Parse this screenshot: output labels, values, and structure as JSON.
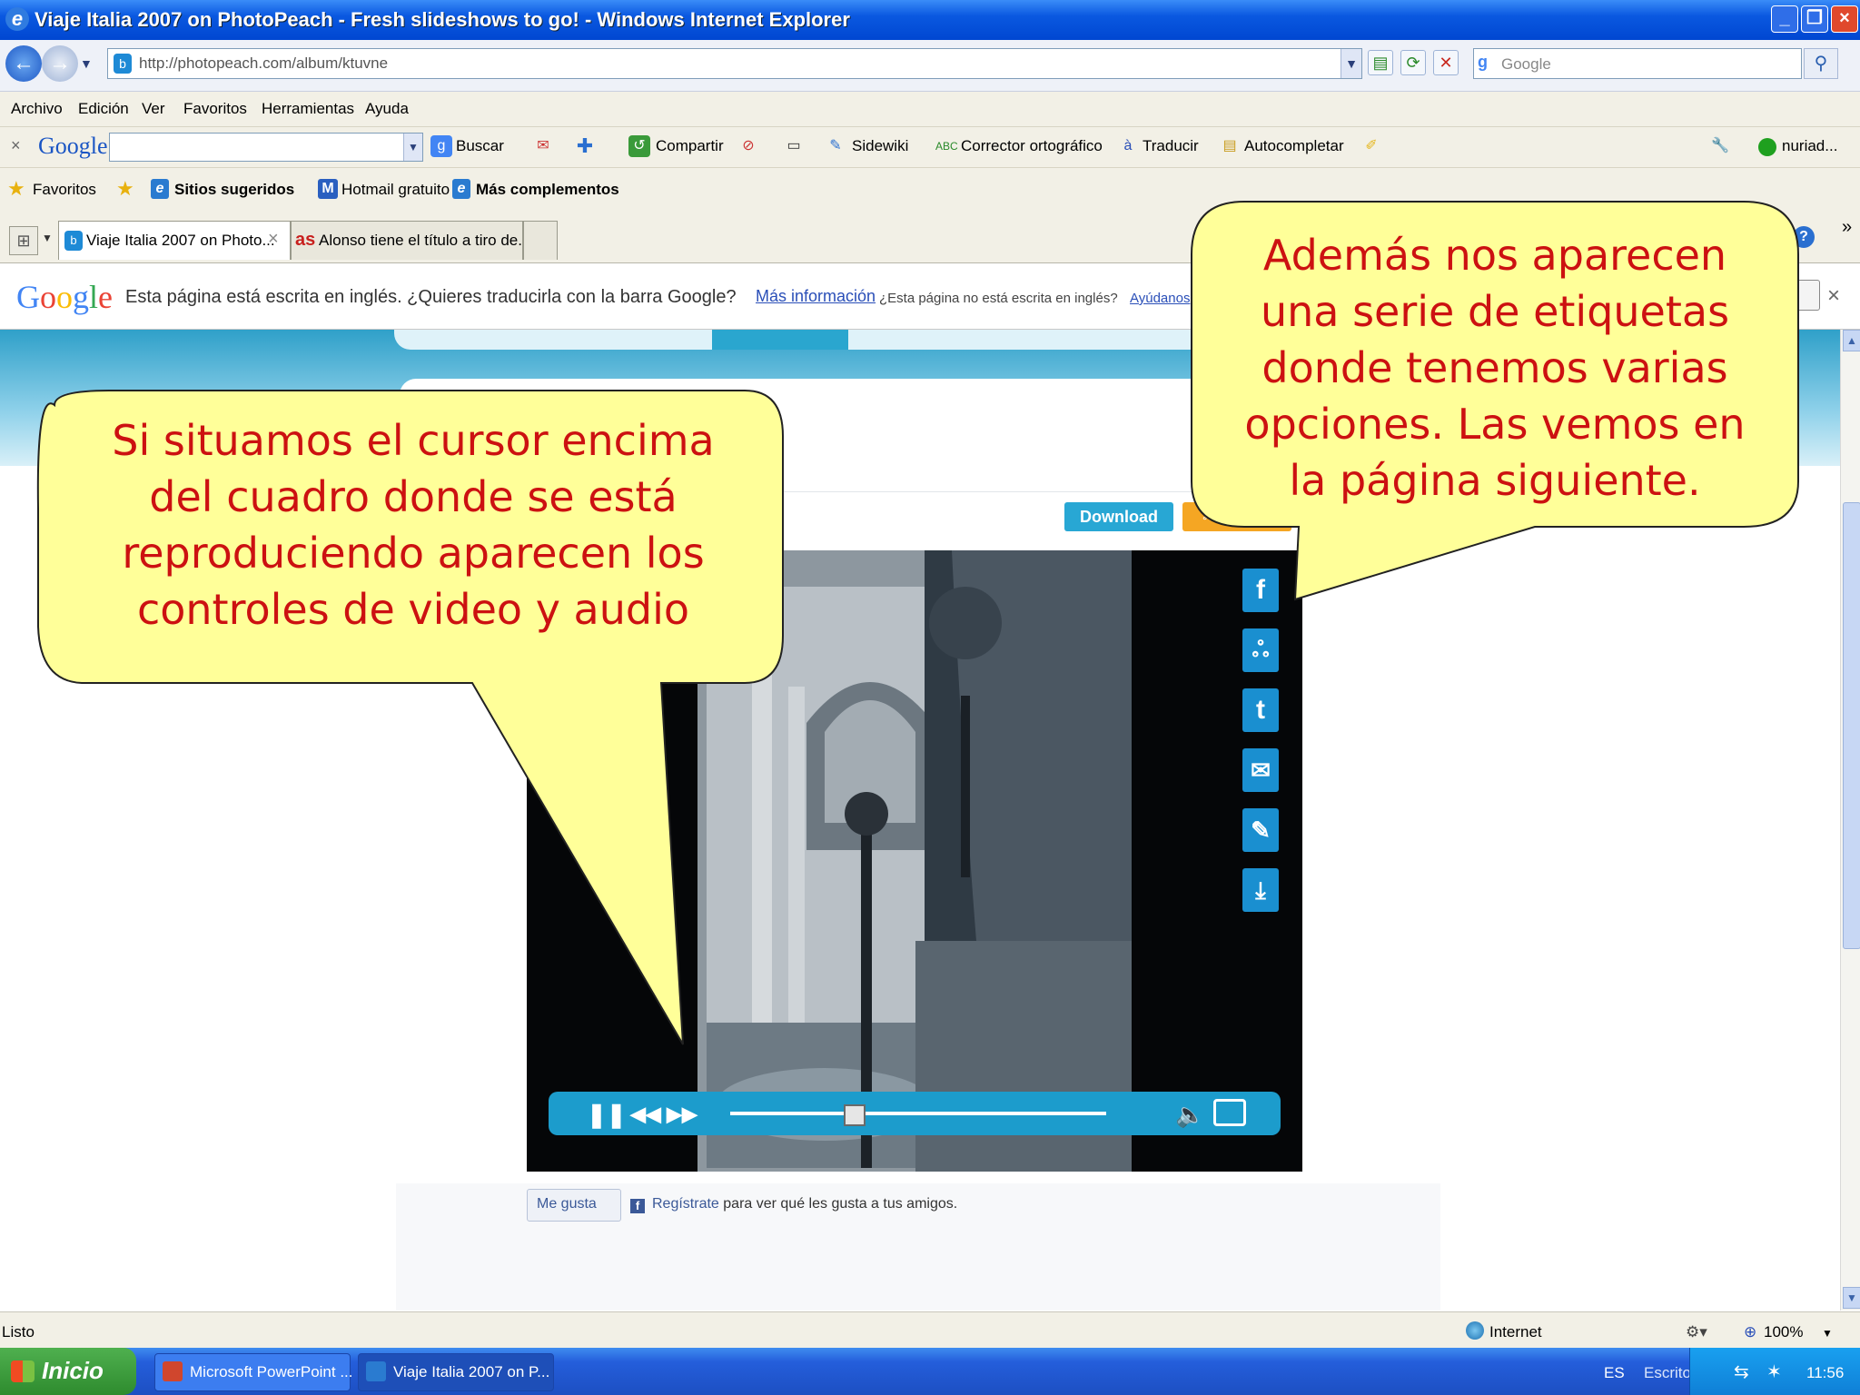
{
  "window": {
    "title": "Viaje Italia 2007 on PhotoPeach - Fresh slideshows to go! - Windows Internet Explorer"
  },
  "address": {
    "url": "http://photopeach.com/album/ktuvne",
    "search_placeholder": "Google"
  },
  "menu": [
    "Archivo",
    "Edición",
    "Ver",
    "Favoritos",
    "Herramientas",
    "Ayuda"
  ],
  "google_toolbar": {
    "logo": "Google",
    "buscar": "Buscar",
    "compartir": "Compartir",
    "sidewiki": "Sidewiki",
    "corrector": "Corrector ortográfico",
    "traducir": "Traducir",
    "autocompletar": "Autocompletar",
    "user": "nuriad..."
  },
  "favorites_bar": {
    "favoritos": "Favoritos",
    "sitios": "Sitios sugeridos",
    "hotmail": "Hotmail gratuito",
    "complementos": "Más complementos"
  },
  "tabs": [
    {
      "label": "Viaje Italia 2007 on Photo..."
    },
    {
      "label": "Alonso tiene el título a tiro de..."
    }
  ],
  "translate_bar": {
    "logo": "Google",
    "message": "Esta página está escrita en inglés. ¿Quieres traducirla con la barra Google?",
    "more_info": "Más información",
    "not_english": "¿Esta página no está escrita en inglés?",
    "help": "Ayúdanos"
  },
  "page": {
    "download_label": "Download",
    "like_label": "Me gusta",
    "register_link": "Regístrate",
    "register_rest": "para ver qué les gusta a tus amigos.",
    "progress_fraction": 0.33
  },
  "status": {
    "text": "Listo",
    "zone": "Internet",
    "zoom": "100%"
  },
  "taskbar": {
    "start": "Inicio",
    "tasks": [
      "Microsoft PowerPoint ...",
      "Viaje Italia 2007 on P..."
    ],
    "lang": "ES",
    "desktop": "Escritorio",
    "clock": "11:56"
  },
  "callouts": {
    "left": [
      "Si situamos el cursor encima",
      "del cuadro donde se está",
      "reproduciendo aparecen los",
      "controles de video y audio"
    ],
    "right": [
      "Además nos aparecen",
      "una serie de etiquetas",
      "donde tenemos varias",
      "opciones. Las vemos en",
      "la página siguiente."
    ]
  },
  "colors": {
    "callout_fill": "#ffff99",
    "callout_text": "#cc1111",
    "accent": "#1c9ccc"
  }
}
